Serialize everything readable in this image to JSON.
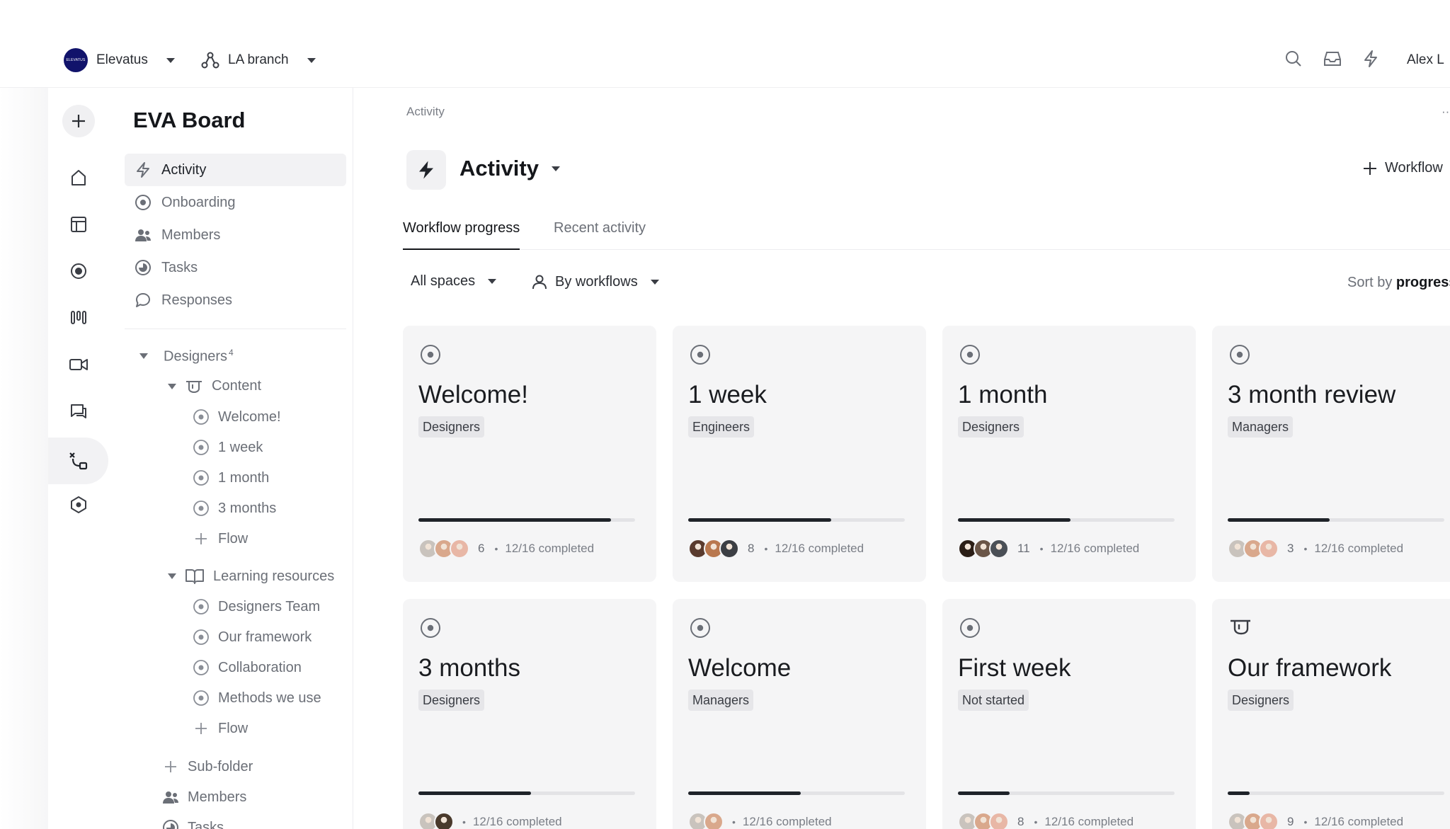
{
  "topbar": {
    "org_logo_text": "ELEVATUS",
    "org_name": "Elevatus",
    "branch_name": "LA branch",
    "user_name": "Alex L"
  },
  "sidebar": {
    "title": "EVA Board",
    "nav": [
      {
        "label": "Activity",
        "icon": "lightning-icon",
        "active": true
      },
      {
        "label": "Onboarding",
        "icon": "target-icon"
      },
      {
        "label": "Members",
        "icon": "people-icon"
      },
      {
        "label": "Tasks",
        "icon": "task-circle-icon"
      },
      {
        "label": "Responses",
        "icon": "chat-bubble-icon"
      }
    ],
    "tree": {
      "designers_label": "Designers",
      "designers_count": "4",
      "content_label": "Content",
      "content_items": [
        "Welcome!",
        "1 week",
        "1 month",
        "3 months"
      ],
      "add_flow_label": "Flow",
      "learning_label": "Learning resources",
      "learning_items": [
        "Designers Team",
        "Our framework",
        "Collaboration",
        "Methods we use"
      ],
      "add_flow_label_2": "Flow",
      "subfolder_label": "Sub-folder",
      "members_label": "Members",
      "tasks_label": "Tasks"
    }
  },
  "main": {
    "breadcrumb": "Activity",
    "more": "··",
    "title": "Activity",
    "add_workflow_label": "Workflow",
    "tabs": [
      "Workflow progress",
      "Recent activity"
    ],
    "filters": {
      "spaces": "All spaces",
      "group": "By workflows"
    },
    "sort_label": "Sort by",
    "sort_value": "progress",
    "cards": [
      {
        "title": "Welcome!",
        "tag": "Designers",
        "progress": 0.89,
        "count": "6",
        "completed": "12/16 completed",
        "icon": "target-icon",
        "avatars": [
          "#c9c3bd",
          "#d9a88c",
          "#e8b7a6"
        ]
      },
      {
        "title": "1 week",
        "tag": "Engineers",
        "progress": 0.66,
        "count": "8",
        "completed": "12/16 completed",
        "icon": "target-icon",
        "avatars": [
          "#5a3b2e",
          "#b9784f",
          "#3c3f44"
        ]
      },
      {
        "title": "1 month",
        "tag": "Designers",
        "progress": 0.52,
        "count": "11",
        "completed": "12/16 completed",
        "icon": "target-icon",
        "avatars": [
          "#2b1e16",
          "#6a5547",
          "#4a4f56"
        ]
      },
      {
        "title": "3 month review",
        "tag": "Managers",
        "progress": 0.47,
        "count": "3",
        "completed": "12/16 completed",
        "icon": "target-icon",
        "avatars": [
          "#c9c3bd",
          "#d9a88c",
          "#e8b7a6"
        ]
      },
      {
        "title": "3 months",
        "tag": "Designers",
        "progress": 0.52,
        "count": "",
        "completed": "12/16 completed",
        "icon": "target-icon",
        "avatars": [
          "#c9c3bd",
          "#4a3a2c"
        ]
      },
      {
        "title": "Welcome",
        "tag": "Managers",
        "progress": 0.52,
        "count": "",
        "completed": "12/16 completed",
        "icon": "target-icon",
        "avatars": [
          "#c9c3bd",
          "#d9a88c"
        ]
      },
      {
        "title": "First week",
        "tag": "Not started",
        "progress": 0.24,
        "count": "8",
        "completed": "12/16 completed",
        "icon": "target-icon",
        "avatars": [
          "#c9c3bd",
          "#d9a88c",
          "#e8b7a6"
        ]
      },
      {
        "title": "Our framework",
        "tag": "Designers",
        "progress": 0.1,
        "count": "9",
        "completed": "12/16 completed",
        "icon": "content-icon",
        "avatars": [
          "#c9c3bd",
          "#d9a88c",
          "#e8b7a6"
        ]
      }
    ]
  }
}
